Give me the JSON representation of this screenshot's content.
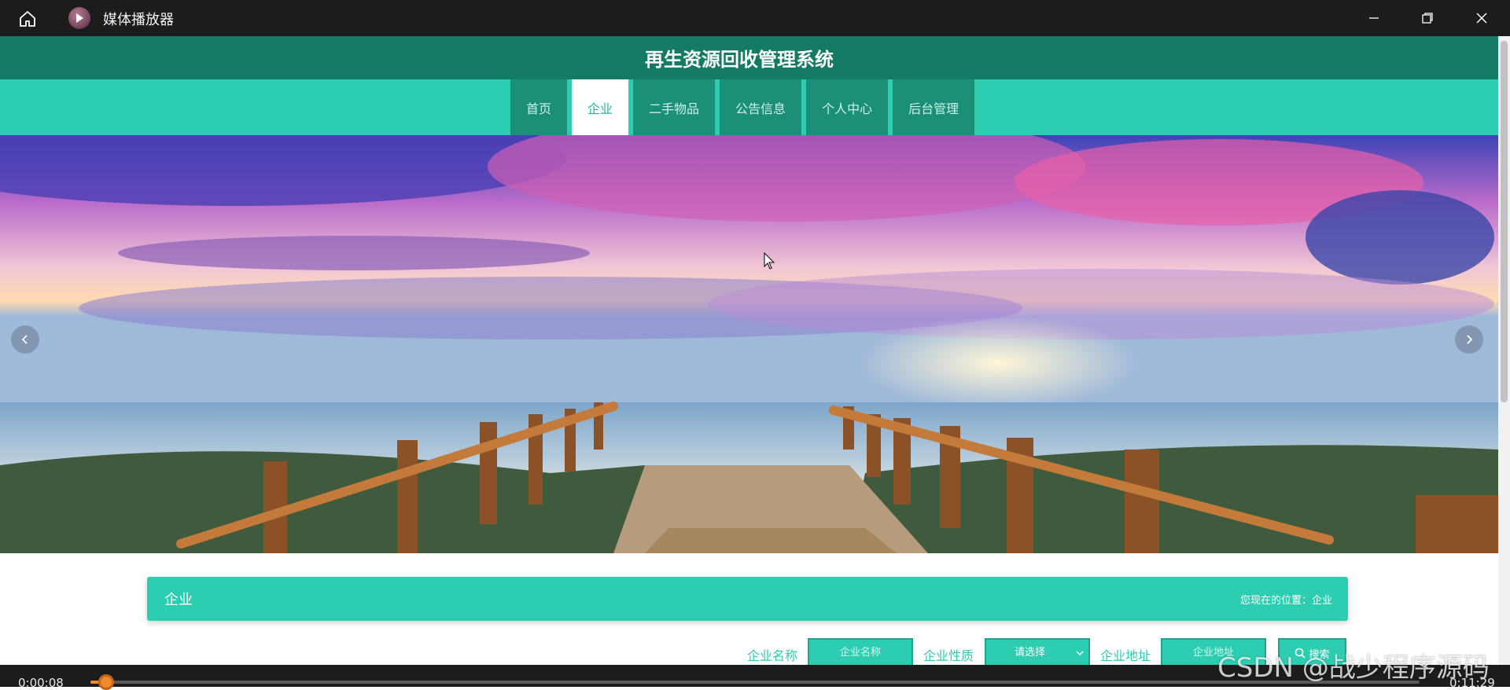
{
  "player": {
    "app_title": "媒体播放器",
    "current_time": "0:00:08",
    "total_time": "0:11:29",
    "progress_fraction": 0.012,
    "accent_color": "#f08a2c"
  },
  "site": {
    "title": "再生资源回收管理系统",
    "nav": [
      {
        "label": "首页",
        "active": false
      },
      {
        "label": "企业",
        "active": true
      },
      {
        "label": "二手物品",
        "active": false
      },
      {
        "label": "公告信息",
        "active": false
      },
      {
        "label": "个人中心",
        "active": false
      },
      {
        "label": "后台管理",
        "active": false
      }
    ],
    "colors": {
      "header": "#137a63",
      "primary": "#2dcdb2",
      "nav_item": "#1c8f77"
    }
  },
  "banner": {
    "slide_count": 3,
    "active_slide": 1,
    "prev_icon": "chevron-left-icon",
    "next_icon": "chevron-right-icon"
  },
  "section": {
    "title": "企业",
    "breadcrumb_prefix": "您现在的位置：",
    "breadcrumb_current": "企业"
  },
  "search": {
    "name_label": "企业名称",
    "name_placeholder": "企业名称",
    "nature_label": "企业性质",
    "nature_selected": "请选择",
    "address_label": "企业地址",
    "address_placeholder": "企业地址",
    "button_label": "搜索"
  },
  "watermark": "CSDN @战少程序源码"
}
